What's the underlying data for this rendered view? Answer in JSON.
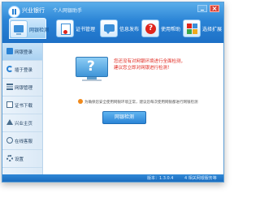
{
  "app": {
    "title": "兴业银行",
    "subtitle": "个人网银助手"
  },
  "tabs": [
    {
      "label": "网银检测",
      "icon": "monitor-icon",
      "active": true
    },
    {
      "label": "证书管理",
      "icon": "certificate-icon",
      "active": false
    },
    {
      "label": "信息发布",
      "icon": "message-icon",
      "active": false
    },
    {
      "label": "使用帮助",
      "icon": "help-icon",
      "active": false
    },
    {
      "label": "选择扩展",
      "icon": "extension-icon",
      "active": false
    }
  ],
  "sidebar": {
    "items": [
      {
        "label": "网银登录",
        "icon": "login-icon",
        "active": true
      },
      {
        "label": "插于登录",
        "icon": "refresh-icon",
        "active": false
      },
      {
        "label": "网银管理",
        "icon": "list-icon",
        "active": false
      },
      {
        "label": "证书下载",
        "icon": "certificate-icon",
        "active": false
      },
      {
        "label": "兴业主页",
        "icon": "home-icon",
        "active": false
      },
      {
        "label": "在线客服",
        "icon": "support-icon",
        "active": false
      },
      {
        "label": "设置",
        "icon": "gear-icon",
        "active": false
      }
    ]
  },
  "main": {
    "warning_line1": "您还没有对网银环境进行全面检测，",
    "warning_line2": "建议您立即对网银进行检测！",
    "tip": "为确保您安全使用网银环境正常，建议您每次使用网银都进行网银检测",
    "detect_button": "网银检测"
  },
  "status": {
    "version": "版本：1.3.0.4",
    "right": "4 相关网银服务等"
  },
  "colors": {
    "accent": "#2a82d4",
    "warning": "#e0251c",
    "tip_icon": "#f08a1c"
  }
}
